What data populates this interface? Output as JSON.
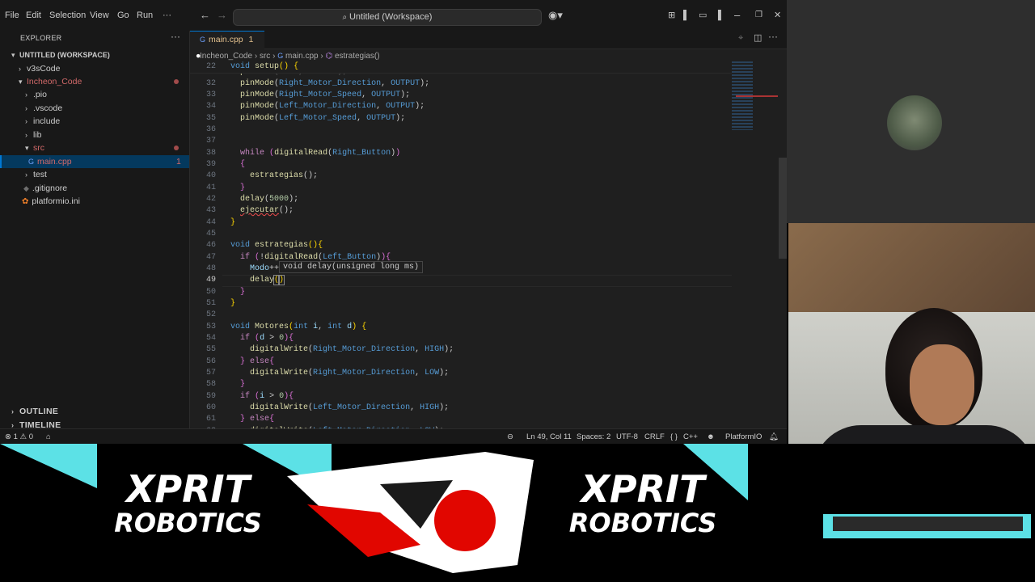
{
  "menu": [
    "File",
    "Edit",
    "Selection",
    "View",
    "Go",
    "Run",
    "···"
  ],
  "command_center": "Untitled (Workspace)",
  "explorer": {
    "title": "EXPLORER",
    "more": "···",
    "workspace": "UNTITLED (WORKSPACE)",
    "items": [
      {
        "label": "v3sCode",
        "kind": "folder"
      },
      {
        "label": "Incheon_Code",
        "kind": "folder-open"
      },
      {
        "label": ".pio",
        "kind": "folder"
      },
      {
        "label": ".vscode",
        "kind": "folder"
      },
      {
        "label": "include",
        "kind": "folder"
      },
      {
        "label": "lib",
        "kind": "folder"
      },
      {
        "label": "src",
        "kind": "folder-open"
      },
      {
        "label": "main.cpp",
        "kind": "file",
        "badge": "1"
      },
      {
        "label": "test",
        "kind": "folder"
      },
      {
        "label": ".gitignore",
        "kind": "file"
      },
      {
        "label": "platformio.ini",
        "kind": "file"
      }
    ],
    "outline": "OUTLINE",
    "timeline": "TIMELINE"
  },
  "tab": {
    "label": "main.cpp",
    "badge": "1"
  },
  "breadcrumb": [
    "Incheon_Code",
    "src",
    "main.cpp",
    "estrategias()"
  ],
  "code": {
    "sticky_line": "22",
    "sticky_text": "void setup() {",
    "active_line": "49",
    "lines": [
      "32",
      "33",
      "34",
      "35",
      "36",
      "37",
      "38",
      "39",
      "40",
      "41",
      "42",
      "43",
      "44",
      "45",
      "46",
      "47",
      "48",
      "49",
      "50",
      "51",
      "52",
      "53",
      "54",
      "55",
      "56",
      "57",
      "58",
      "59",
      "60",
      "61",
      "62"
    ]
  },
  "hover_tooltip": "void delay(unsigned long ms)",
  "status": {
    "problems_errors": "1",
    "problems_warnings": "0",
    "position": "Ln 49, Col 11",
    "spaces": "Spaces: 2",
    "encoding": "UTF-8",
    "eol": "CRLF",
    "language": "C++",
    "platform": "PlatformIO"
  },
  "banner": {
    "left_line1": "XPRIT",
    "left_line2": "ROBOTICS",
    "right_line1": "XPRIT",
    "right_line2": "ROBOTICS"
  },
  "colors": {
    "accent": "#0078d4",
    "banner_cyan": "#5ce1e6",
    "banner_red": "#e10600"
  }
}
